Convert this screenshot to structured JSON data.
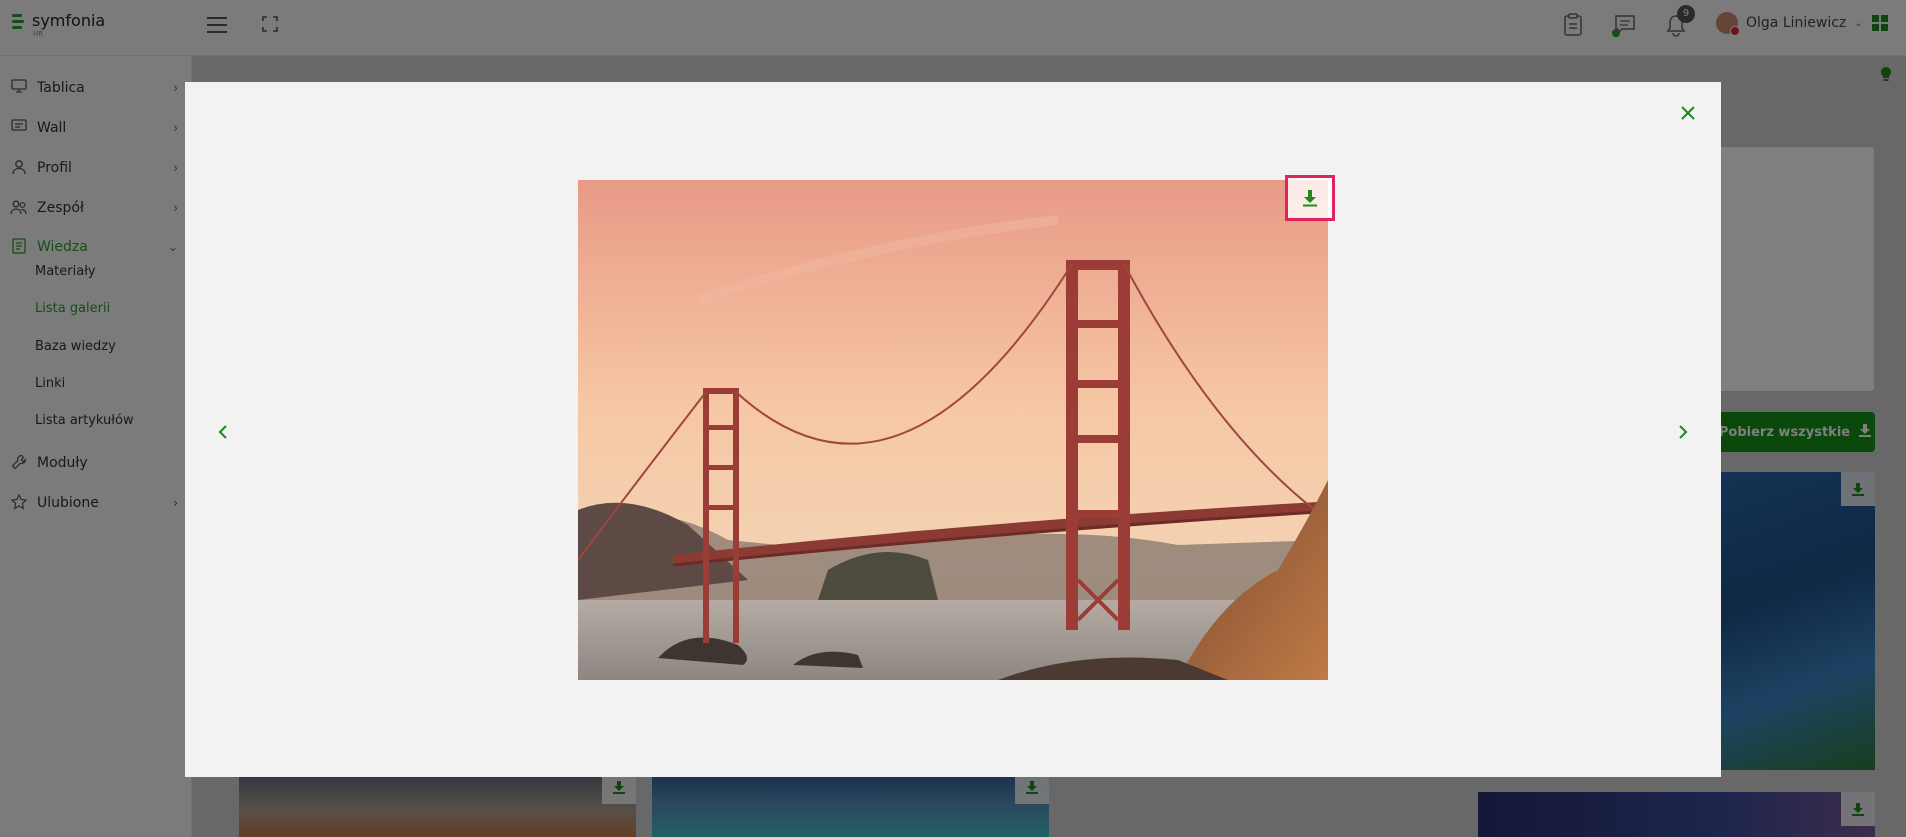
{
  "app": {
    "logo_text": "symfonia",
    "logo_sub": "HR"
  },
  "header": {
    "notifications_count": "9",
    "user_name": "Olga Liniewicz",
    "icons": [
      "clipboard-icon",
      "chat-icon",
      "bell-icon",
      "apps-grid-icon"
    ]
  },
  "sidebar": {
    "items": [
      {
        "label": "Tablica",
        "icon": "monitor-icon",
        "chevron": "›"
      },
      {
        "label": "Wall",
        "icon": "wall-icon",
        "chevron": "›"
      },
      {
        "label": "Profil",
        "icon": "person-icon",
        "chevron": "›"
      },
      {
        "label": "Zespół",
        "icon": "team-icon",
        "chevron": "›"
      },
      {
        "label": "Wiedza",
        "icon": "book-icon",
        "chevron": "⌄"
      },
      {
        "label": "Moduły",
        "icon": "wrench-icon",
        "chevron": ""
      },
      {
        "label": "Ulubione",
        "icon": "star-icon",
        "chevron": "›"
      }
    ],
    "sub_items": [
      "Materiały",
      "Lista galerii",
      "Baza wiedzy",
      "Linki",
      "Lista artykułów"
    ]
  },
  "background": {
    "download_all_label": "Pobierz wszystkie"
  },
  "modal": {
    "close_icon": "close-icon",
    "prev_icon": "chevron-left-icon",
    "next_icon": "chevron-right-icon",
    "download_icon": "download-icon"
  },
  "colors": {
    "accent": "#2e9b2e",
    "button": "#169016",
    "highlight": "#e0245e"
  }
}
